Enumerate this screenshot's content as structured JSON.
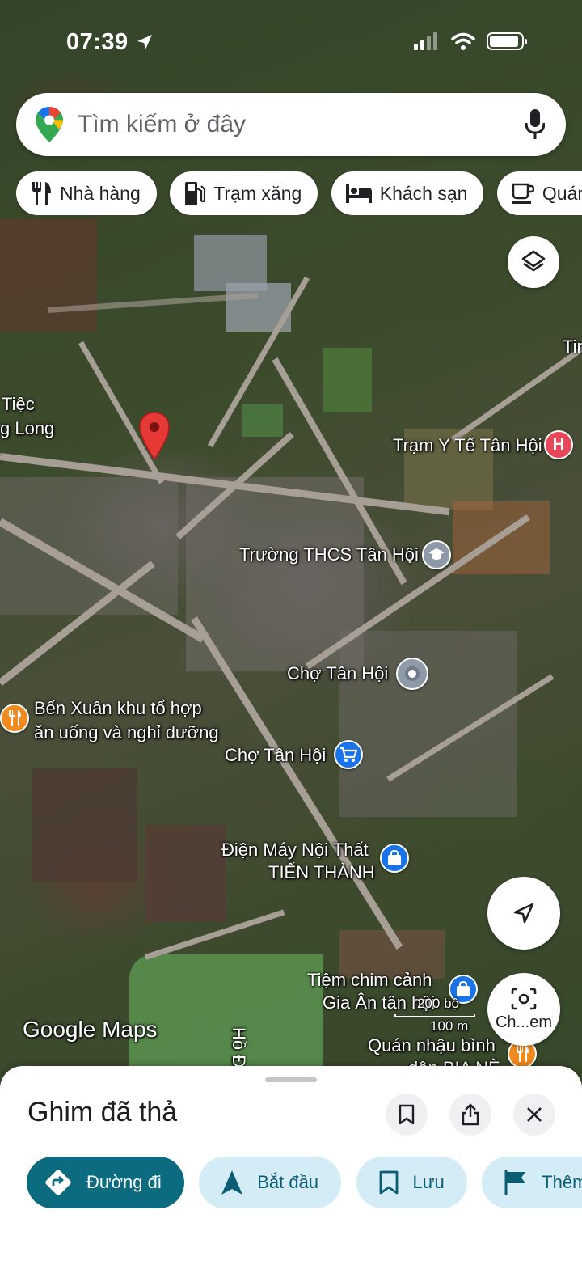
{
  "status_bar": {
    "time": "07:39"
  },
  "search": {
    "placeholder": "Tìm kiếm ở đây"
  },
  "chips": [
    {
      "label": "Nhà hàng",
      "icon": "fork-knife-icon"
    },
    {
      "label": "Trạm xăng",
      "icon": "gas-station-icon"
    },
    {
      "label": "Khách sạn",
      "icon": "bed-icon"
    },
    {
      "label": "Quán c",
      "icon": "coffee-icon"
    }
  ],
  "map": {
    "labels": {
      "tiec": "Tiệc",
      "long": "g Long",
      "tin": "Tin",
      "tram_y_te": "Trạm Y Tế Tân Hội",
      "truong": "Trường THCS Tân Hội",
      "cho_1": "Chợ Tân Hội",
      "ben_xuan_1": "Bến Xuân khu tổ hợp",
      "ben_xuan_2": "ăn uống và nghỉ dưỡng",
      "cho_2": "Chợ Tân Hội",
      "dien_may_1": "Điện Máy Nội Thất",
      "dien_may_2": "TIẾN THÀNH",
      "tiem_chim_1": "Tiệm chim cảnh",
      "tiem_chim_2": "Gia Ân tân hội",
      "quan_nhau_1": "Quán nhậu bình",
      "quan_nhau_2": "dân BIA NÈ",
      "lake": "Hồ Đằ",
      "scale_top": "200 bộ",
      "scale_bottom": "100 m"
    },
    "watermark": "Google Maps",
    "live_view_label": "Ch...em"
  },
  "sheet": {
    "title": "Ghim đã thả",
    "actions": [
      {
        "label": "Đường đi",
        "icon": "directions-icon"
      },
      {
        "label": "Bắt đầu",
        "icon": "navigation-arrow-icon"
      },
      {
        "label": "Lưu",
        "icon": "bookmark-icon"
      },
      {
        "label": "Thêm",
        "icon": "flag-icon"
      }
    ]
  },
  "colors": {
    "primary_action": "#0d6b80",
    "secondary_action": "#d3ecf5",
    "pin": "#e53935",
    "hospital": "#e8475a",
    "restaurant": "#f28b1f",
    "shopping": "#1a73e8"
  }
}
